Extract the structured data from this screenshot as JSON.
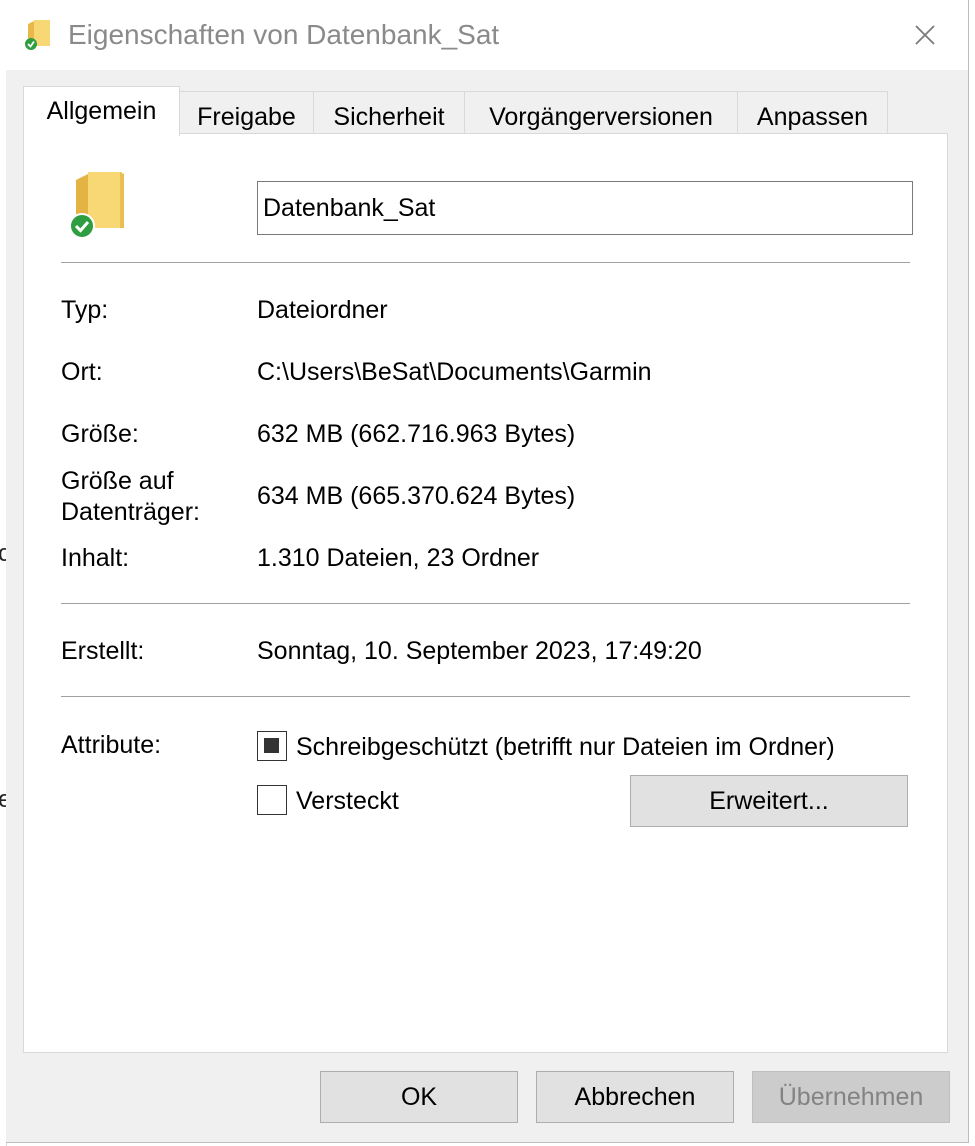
{
  "window": {
    "title": "Eigenschaften von Datenbank_Sat",
    "close_symbol": "✕"
  },
  "tabs": [
    {
      "label": "Allgemein",
      "active": true
    },
    {
      "label": "Freigabe",
      "active": false
    },
    {
      "label": "Sicherheit",
      "active": false
    },
    {
      "label": "Vorgängerversionen",
      "active": false
    },
    {
      "label": "Anpassen",
      "active": false
    }
  ],
  "general": {
    "folder_icon": "folder-with-sync-check-icon",
    "name_value": "Datenbank_Sat",
    "type_label": "Typ:",
    "type_value": "Dateiordner",
    "location_label": "Ort:",
    "location_value": "C:\\Users\\BeSat\\Documents\\Garmin",
    "size_label": "Größe:",
    "size_value": "632 MB (662.716.963 Bytes)",
    "size_on_disk_label_line1": "Größe auf",
    "size_on_disk_label_line2": "Datenträger:",
    "size_on_disk_value": "634 MB (665.370.624 Bytes)",
    "contents_label": "Inhalt:",
    "contents_value": "1.310 Dateien, 23 Ordner",
    "created_label": "Erstellt:",
    "created_value": "Sonntag, 10. September 2023, 17:49:20",
    "attributes_label": "Attribute:",
    "readonly_label": "Schreibgeschützt (betrifft nur Dateien im Ordner)",
    "readonly_state": "indeterminate",
    "hidden_label": "Versteckt",
    "hidden_state": "unchecked",
    "advanced_button": "Erweitert..."
  },
  "footer": {
    "ok": "OK",
    "cancel": "Abbrechen",
    "apply": "Übernehmen",
    "apply_enabled": false
  },
  "background_fragments": [
    "c",
    "e"
  ],
  "colors": {
    "folder": "#f8d775",
    "sync_check": "#2e9e41",
    "title_text": "#8a8a8a",
    "dialog_bg": "#f0f0f0"
  }
}
